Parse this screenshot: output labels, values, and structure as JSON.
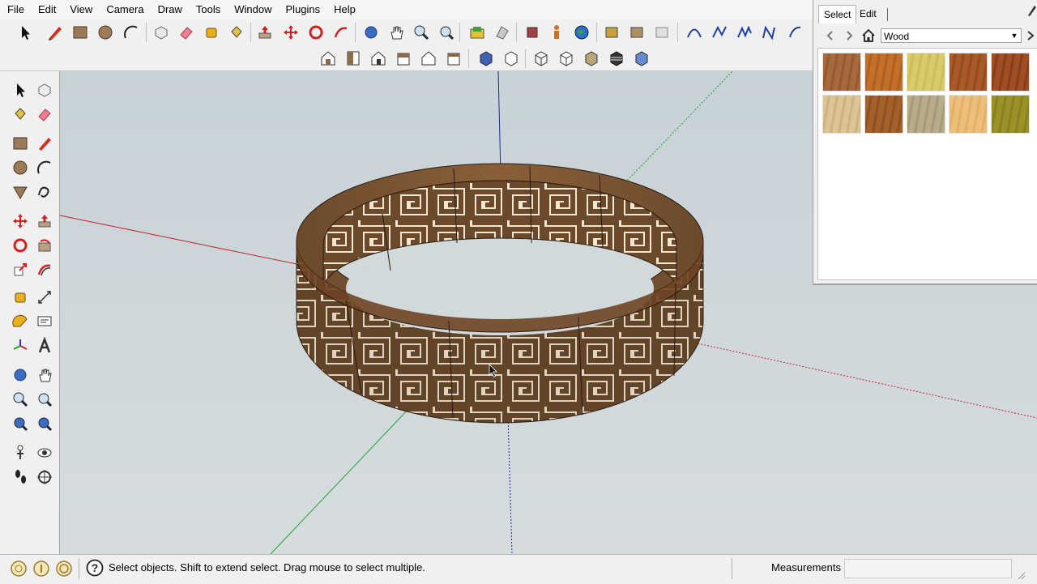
{
  "menus": [
    "File",
    "Edit",
    "View",
    "Camera",
    "Draw",
    "Tools",
    "Window",
    "Plugins",
    "Help"
  ],
  "materials": {
    "tabs": [
      "Select",
      "Edit"
    ],
    "collection": "Wood",
    "swatches": [
      {
        "name": "wood-cherry",
        "color": "#a86a3c",
        "accent": "#8e5530"
      },
      {
        "name": "wood-orange",
        "color": "#c4702a",
        "accent": "#a85c1e"
      },
      {
        "name": "wood-yellow",
        "color": "#d8cc6a",
        "accent": "#c8bb55"
      },
      {
        "name": "wood-mahogany",
        "color": "#a95a28",
        "accent": "#8f481c"
      },
      {
        "name": "wood-redgrain",
        "color": "#a24e24",
        "accent": "#7e3a18"
      },
      {
        "name": "wood-pale",
        "color": "#dcc494",
        "accent": "#c9ae7c"
      },
      {
        "name": "wood-walnut",
        "color": "#a5602a",
        "accent": "#874c1e"
      },
      {
        "name": "wood-gray",
        "color": "#b8ad8a",
        "accent": "#a09574"
      },
      {
        "name": "wood-light",
        "color": "#ecc07a",
        "accent": "#deac60"
      },
      {
        "name": "wood-olive",
        "color": "#9a9228",
        "accent": "#847c1c"
      }
    ]
  },
  "status": {
    "message": "Select objects. Shift to extend select. Drag mouse to select multiple.",
    "measurements_label": "Measurements",
    "measurements_value": ""
  }
}
